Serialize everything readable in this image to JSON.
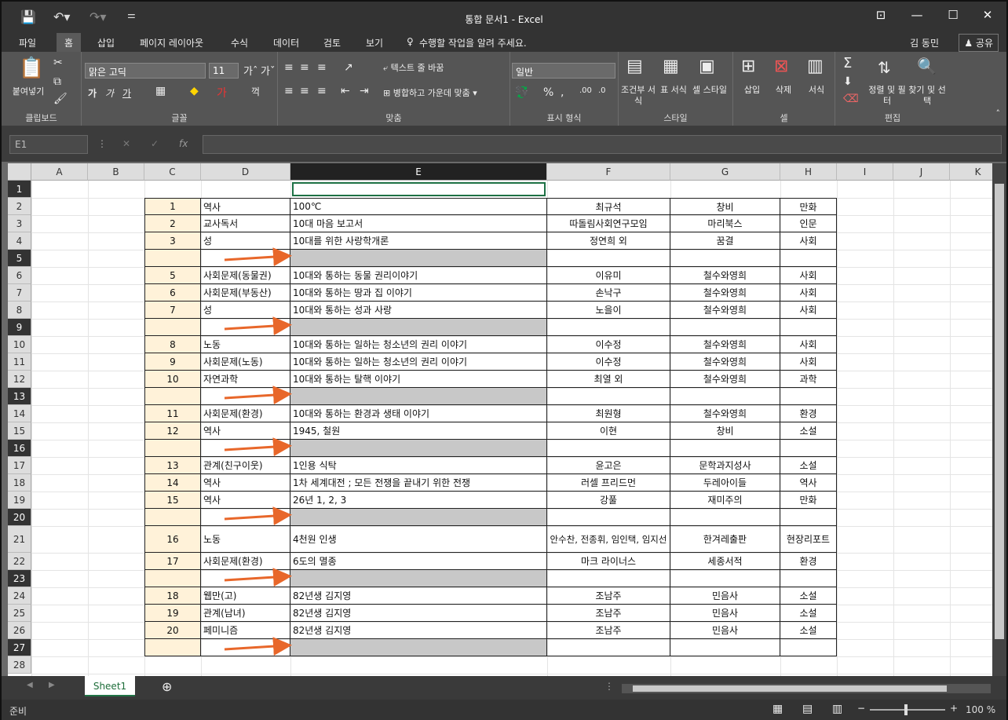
{
  "window": {
    "title": "통합 문서1  -  Excel"
  },
  "tabs": [
    "파일",
    "홈",
    "삽입",
    "페이지 레이아웃",
    "수식",
    "데이터",
    "검토",
    "보기"
  ],
  "tell_me": "수행할 작업을 알려 주세요.",
  "user": "김 동민",
  "share": "공유",
  "ribbon": {
    "clipboard": {
      "paste": "붙여넣기",
      "label": "클립보드"
    },
    "font": {
      "name": "맑은 고딕",
      "size": "11",
      "label": "글꼴"
    },
    "align": {
      "wrap": "텍스트 줄 바꿈",
      "merge": "병합하고 가운데 맞춤",
      "label": "맞춤"
    },
    "number": {
      "format": "일반",
      "label": "표시 형식"
    },
    "styles": {
      "cond": "조건부 서식",
      "table": "표 서식",
      "cell": "셀 스타일",
      "label": "스타일"
    },
    "cells": {
      "insert": "삽입",
      "delete": "삭제",
      "format": "서식",
      "label": "셀"
    },
    "edit": {
      "sort": "정렬 및 필터",
      "find": "찾기 및 선택",
      "label": "편집"
    }
  },
  "namebox": "E1",
  "columns": [
    "A",
    "B",
    "C",
    "D",
    "E",
    "F",
    "G",
    "H",
    "I",
    "J",
    "K"
  ],
  "rows": [
    {
      "n": "1",
      "no": "",
      "cat": "",
      "title": "",
      "author": "",
      "pub": "",
      "genre": "",
      "gray": false
    },
    {
      "n": "2",
      "no": "1",
      "cat": "역사",
      "title": "100℃",
      "author": "최규석",
      "pub": "창비",
      "genre": "만화",
      "gray": false
    },
    {
      "n": "3",
      "no": "2",
      "cat": "교사독서",
      "title": "10대 마음 보고서",
      "author": "따돌림사회연구모임",
      "pub": "마리북스",
      "genre": "인문",
      "gray": false
    },
    {
      "n": "4",
      "no": "3",
      "cat": "성",
      "title": "10대를 위한 사랑학개론",
      "author": "정연희 외",
      "pub": "꿈결",
      "genre": "사회",
      "gray": false
    },
    {
      "n": "5",
      "no": "",
      "cat": "",
      "title": "",
      "author": "",
      "pub": "",
      "genre": "",
      "gray": true
    },
    {
      "n": "6",
      "no": "5",
      "cat": "사회문제(동물권)",
      "title": "10대와 통하는 동물 권리이야기",
      "author": "이유미",
      "pub": "철수와영희",
      "genre": "사회",
      "gray": false
    },
    {
      "n": "7",
      "no": "6",
      "cat": "사회문제(부동산)",
      "title": "10대와 통하는 땅과 집 이야기",
      "author": "손낙구",
      "pub": "철수와영희",
      "genre": "사회",
      "gray": false
    },
    {
      "n": "8",
      "no": "7",
      "cat": "성",
      "title": "10대와 통하는 성과 사랑",
      "author": "노을이",
      "pub": "철수와영희",
      "genre": "사회",
      "gray": false
    },
    {
      "n": "9",
      "no": "",
      "cat": "",
      "title": "",
      "author": "",
      "pub": "",
      "genre": "",
      "gray": true
    },
    {
      "n": "10",
      "no": "8",
      "cat": "노동",
      "title": "10대와 통하는 일하는 청소년의 권리 이야기",
      "author": "이수정",
      "pub": "철수와영희",
      "genre": "사회",
      "gray": false
    },
    {
      "n": "11",
      "no": "9",
      "cat": "사회문제(노동)",
      "title": "10대와 통하는 일하는 청소년의 권리 이야기",
      "author": "이수정",
      "pub": "철수와영희",
      "genre": "사회",
      "gray": false
    },
    {
      "n": "12",
      "no": "10",
      "cat": "자연과학",
      "title": "10대와 통하는 탈핵 이야기",
      "author": "최열 외",
      "pub": "철수와영희",
      "genre": "과학",
      "gray": false
    },
    {
      "n": "13",
      "no": "",
      "cat": "",
      "title": "",
      "author": "",
      "pub": "",
      "genre": "",
      "gray": true
    },
    {
      "n": "14",
      "no": "11",
      "cat": "사회문제(환경)",
      "title": "10대와 통하는 환경과 생태 이야기",
      "author": "최원형",
      "pub": "철수와영희",
      "genre": "환경",
      "gray": false
    },
    {
      "n": "15",
      "no": "12",
      "cat": "역사",
      "title": "1945, 철원",
      "author": "이현",
      "pub": "창비",
      "genre": "소설",
      "gray": false
    },
    {
      "n": "16",
      "no": "",
      "cat": "",
      "title": "",
      "author": "",
      "pub": "",
      "genre": "",
      "gray": true
    },
    {
      "n": "17",
      "no": "13",
      "cat": "관계(친구이웃)",
      "title": "1인용 식탁",
      "author": "윤고은",
      "pub": "문학과지성사",
      "genre": "소설",
      "gray": false
    },
    {
      "n": "18",
      "no": "14",
      "cat": "역사",
      "title": "1차 세계대전 ; 모든 전쟁을 끝내기 위한 전쟁",
      "author": "러셀 프리드먼",
      "pub": "두레아이들",
      "genre": "역사",
      "gray": false
    },
    {
      "n": "19",
      "no": "15",
      "cat": "역사",
      "title": "26년 1, 2, 3",
      "author": "강풀",
      "pub": "재미주의",
      "genre": "만화",
      "gray": false
    },
    {
      "n": "20",
      "no": "",
      "cat": "",
      "title": "",
      "author": "",
      "pub": "",
      "genre": "",
      "gray": true
    },
    {
      "n": "21",
      "no": "16",
      "cat": "노동",
      "title": "4천원 인생",
      "author": "안수찬, 전종휘, 임인택, 임지선",
      "pub": "한겨레출판",
      "genre": "현장리포트",
      "gray": false
    },
    {
      "n": "22",
      "no": "17",
      "cat": "사회문제(환경)",
      "title": "6도의 멸종",
      "author": "마크 라이너스",
      "pub": "세종서적",
      "genre": "환경",
      "gray": false
    },
    {
      "n": "23",
      "no": "",
      "cat": "",
      "title": "",
      "author": "",
      "pub": "",
      "genre": "",
      "gray": true
    },
    {
      "n": "24",
      "no": "18",
      "cat": "웹만(고)",
      "title": "82년생 김지영",
      "author": "조남주",
      "pub": "민음사",
      "genre": "소설",
      "gray": false
    },
    {
      "n": "25",
      "no": "19",
      "cat": "관계(남녀)",
      "title": "82년생 김지영",
      "author": "조남주",
      "pub": "민음사",
      "genre": "소설",
      "gray": false
    },
    {
      "n": "26",
      "no": "20",
      "cat": "페미니즘",
      "title": "82년생 김지영",
      "author": "조남주",
      "pub": "민음사",
      "genre": "소설",
      "gray": false
    },
    {
      "n": "27",
      "no": "",
      "cat": "",
      "title": "",
      "author": "",
      "pub": "",
      "genre": "",
      "gray": true
    },
    {
      "n": "28",
      "no": "",
      "cat": "",
      "title": "",
      "author": "",
      "pub": "",
      "genre": "",
      "gray": false
    }
  ],
  "sheet": "Sheet1",
  "status": "준비",
  "zoom": "100 %",
  "colors": {
    "arrow": "#e8672a",
    "numfill": "#fff2d9",
    "grayfill": "#c8c8c8",
    "ribbon": "#555555"
  }
}
